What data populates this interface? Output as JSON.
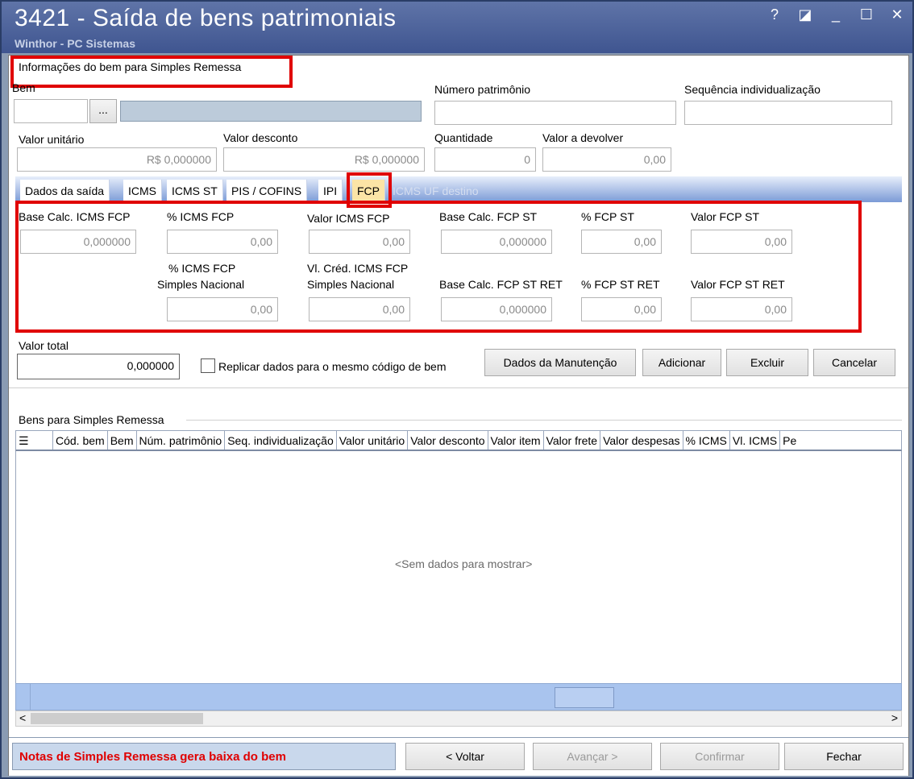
{
  "window": {
    "title": "3421 - Saída de bens patrimoniais",
    "subtitle": "Winthor - PC Sistemas",
    "controls": [
      "?",
      "◪",
      "_",
      "☐",
      "✕"
    ]
  },
  "info_section": {
    "title": "Informações do bem para Simples Remessa",
    "bem_label": "Bem",
    "bem_lookup_button": "...",
    "numero_patrimonio_label": "Número patrimônio",
    "sequencia_label": "Sequência individualização",
    "valor_unitario_label": "Valor unitário",
    "valor_unitario_value": "R$ 0,000000",
    "valor_desconto_label": "Valor desconto",
    "valor_desconto_value": "R$ 0,000000",
    "quantidade_label": "Quantidade",
    "quantidade_value": "0",
    "valor_devolver_label": "Valor a devolver",
    "valor_devolver_value": "0,00"
  },
  "tabs": [
    {
      "label": "Dados da saída",
      "active": false
    },
    {
      "label": "ICMS",
      "active": false
    },
    {
      "label": "ICMS ST",
      "active": false
    },
    {
      "label": "PIS / COFINS",
      "active": false
    },
    {
      "label": "IPI",
      "active": false
    },
    {
      "label": "FCP",
      "active": true
    },
    {
      "label": "ICMS UF destino",
      "active": false,
      "disabled": true
    }
  ],
  "fcp": {
    "base_calc_icms_fcp_label": "Base Calc. ICMS FCP",
    "base_calc_icms_fcp_value": "0,000000",
    "pct_icms_fcp_label": "% ICMS FCP",
    "pct_icms_fcp_value": "0,00",
    "valor_icms_fcp_label": "Valor ICMS FCP",
    "valor_icms_fcp_value": "0,00",
    "base_calc_fcp_st_label": "Base Calc. FCP ST",
    "base_calc_fcp_st_value": "0,000000",
    "pct_fcp_st_label": "% FCP ST",
    "pct_fcp_st_value": "0,00",
    "valor_fcp_st_label": "Valor FCP ST",
    "valor_fcp_st_value": "0,00",
    "pct_icms_fcp_sn_label_1": "% ICMS FCP",
    "pct_icms_fcp_sn_label_2": "Simples Nacional",
    "pct_icms_fcp_sn_value": "0,00",
    "vl_cred_icms_fcp_sn_label_1": "Vl. Créd. ICMS FCP",
    "vl_cred_icms_fcp_sn_label_2": "Simples Nacional",
    "vl_cred_icms_fcp_sn_value": "0,00",
    "base_calc_fcp_st_ret_label": "Base Calc. FCP ST RET",
    "base_calc_fcp_st_ret_value": "0,000000",
    "pct_fcp_st_ret_label": "% FCP ST RET",
    "pct_fcp_st_ret_value": "0,00",
    "valor_fcp_st_ret_label": "Valor FCP ST RET",
    "valor_fcp_st_ret_value": "0,00"
  },
  "totals": {
    "valor_total_label": "Valor total",
    "valor_total_value": "0,000000",
    "replicar_label": "Replicar dados para o mesmo código de bem",
    "replicar_checked": false
  },
  "actions": {
    "dados_manutencao": "Dados da Manutenção",
    "adicionar": "Adicionar",
    "excluir": "Excluir",
    "cancelar": "Cancelar"
  },
  "grid": {
    "title": "Bens para Simples Remessa",
    "columns": [
      "Cód. bem",
      "Bem",
      "Núm. patrimônio",
      "Seq. individualização",
      "Valor unitário",
      "Valor desconto",
      "Valor item",
      "Valor frete",
      "Valor despesas",
      "% ICMS",
      "Vl. ICMS",
      "Pe"
    ],
    "empty_text": "<Sem dados para mostrar>"
  },
  "footer": {
    "status_message": "Notas de Simples Remessa gera baixa do bem",
    "voltar": "< Voltar",
    "avancar": "Avançar >",
    "confirmar": "Confirmar",
    "fechar": "Fechar"
  },
  "colors": {
    "title_bar": "#4f65a0",
    "highlight_red": "#e00000",
    "status_text_red": "#e00000",
    "tab_active_bg": "#fbe4a6"
  }
}
